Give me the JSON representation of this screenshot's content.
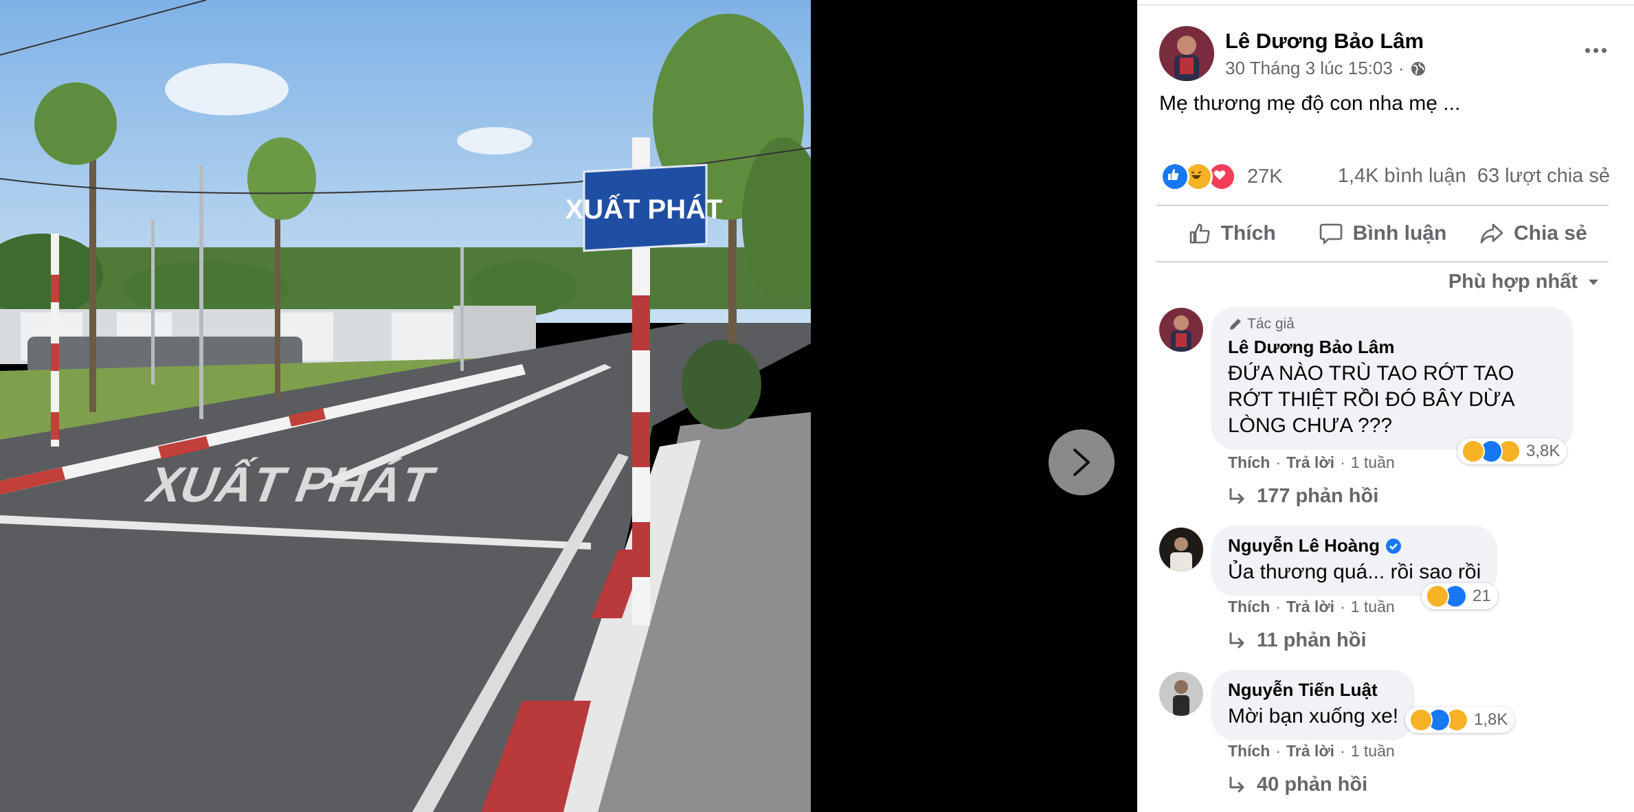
{
  "photo": {
    "sign_text": "XUẤT PHÁT",
    "road_text": "XUẤT PHÁT"
  },
  "post": {
    "author": "Lê Dương Bảo Lâm",
    "timestamp": "30 Tháng 3 lúc 15:03",
    "separator": "·",
    "privacy_icon": "globe-icon",
    "text": "Mẹ thương mẹ độ con nha mẹ ...",
    "reaction_icons": [
      "like",
      "haha",
      "love"
    ],
    "reaction_count": "27K",
    "comments_count": "1,4K bình luận",
    "shares_count": "63 lượt chia sẻ"
  },
  "actions": {
    "like": "Thích",
    "comment": "Bình luận",
    "share": "Chia sẻ"
  },
  "sort": {
    "label": "Phù hợp nhất"
  },
  "comments": [
    {
      "badge": "Tác giả",
      "name": "Lê Dương Bảo Lâm",
      "text": "ĐỨA NÀO TRÙ TAO RỚT TAO RỚT THIỆT RỒI ĐÓ BÂY DỪA LÒNG CHƯA ???",
      "like": "Thích",
      "reply": "Trả lời",
      "time": "1 tuần",
      "reaction_count": "3,8K",
      "replies": "177 phản hồi"
    },
    {
      "name": "Nguyễn Lê Hoàng",
      "verified": true,
      "text": "Ủa thương quá... rồi sao rồi",
      "like": "Thích",
      "reply": "Trả lời",
      "time": "1 tuần",
      "reaction_count": "21",
      "replies": "11 phản hồi"
    },
    {
      "name": "Nguyễn Tiến Luật",
      "text": "Mời bạn xuống xe!",
      "like": "Thích",
      "reply": "Trả lời",
      "time": "1 tuần",
      "reaction_count": "1,8K",
      "replies": "40 phản hồi"
    }
  ],
  "colors": {
    "like_blue": "#1877f2",
    "love_red": "#f33e58",
    "haha_yellow": "#f7b125",
    "secondary_text": "#65676b",
    "bubble_bg": "#f0f2f5"
  }
}
